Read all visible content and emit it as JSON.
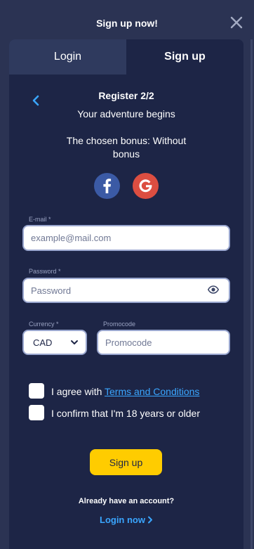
{
  "header": {
    "title": "Sign up now!"
  },
  "tabs": [
    {
      "label": "Login"
    },
    {
      "label": "Sign up"
    }
  ],
  "register": {
    "step": "Register 2/2",
    "subtitle": "Your adventure begins",
    "bonus": "The chosen bonus: Without bonus"
  },
  "social": {
    "facebook_icon": "facebook-icon",
    "google_icon": "google-icon",
    "facebook_color": "#3b5aa5",
    "google_color": "#dc4e41"
  },
  "form": {
    "email": {
      "label": "E-mail *",
      "placeholder": "example@mail.com",
      "value": ""
    },
    "password": {
      "label": "Password *",
      "placeholder": "Password",
      "value": ""
    },
    "currency": {
      "label": "Currency *",
      "value": "CAD"
    },
    "promocode": {
      "label": "Promocode",
      "placeholder": "Promocode",
      "value": ""
    },
    "agree_prefix": "I agree with ",
    "agree_link": "Terms and Conditions",
    "age_confirm": "I confirm that I'm 18 years or older",
    "submit_label": "Sign up"
  },
  "footer": {
    "have_account": "Already have an account?",
    "login_link": "Login now"
  },
  "colors": {
    "accent": "#ffcc00",
    "link": "#3aa6ff",
    "background": "#1d2546"
  }
}
